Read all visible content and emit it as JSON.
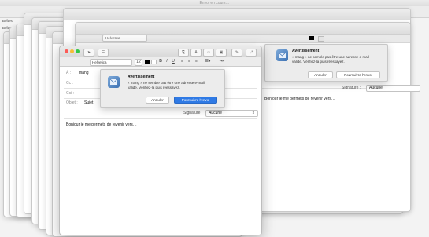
{
  "app": {
    "title": "Envoi en cours…"
  },
  "background": {
    "sidebar_items": [
      "Boîtes",
      "Boîtes aux le…"
    ]
  },
  "back_window": {
    "font_name": "Helvetica",
    "alert": {
      "title": "Avertissement",
      "message": "« mang » ne semble pas être une adresse e-mail valide. Vérifiez-la puis réessayez.",
      "cancel_label": "Annuler",
      "continue_label": "Poursuivre l’envoi"
    },
    "signature_label": "Signature :",
    "signature_value": "Aucune",
    "body_preview": "Bonjour je me permets de revenir vers…"
  },
  "mail": {
    "toolbar": {
      "font_name": "Helvetica",
      "font_size": "12",
      "bold": "B",
      "italic": "I",
      "underline": "U"
    },
    "fields": {
      "to_label": "À :",
      "to_value": "mang",
      "cc_label": "Cc :",
      "bcc_label": "Cci :",
      "subject_label": "Objet :",
      "subject_value": "Sujet"
    },
    "signature": {
      "label": "Signature :",
      "value": "Aucune"
    },
    "body": "Bonjour je me permets de revenir vers…"
  },
  "alert": {
    "title": "Avertissement",
    "message": "« mang » ne semble pas être une adresse e-mail valide. Vérifiez-la puis réessayez.",
    "cancel_label": "Annuler",
    "continue_label": "Poursuivre l’envoi"
  },
  "colors": {
    "primary_button": "#2f7ae5",
    "close_dot": "#fc5b57",
    "minimize_dot": "#f6bd34",
    "zoom_dot": "#35c649"
  }
}
